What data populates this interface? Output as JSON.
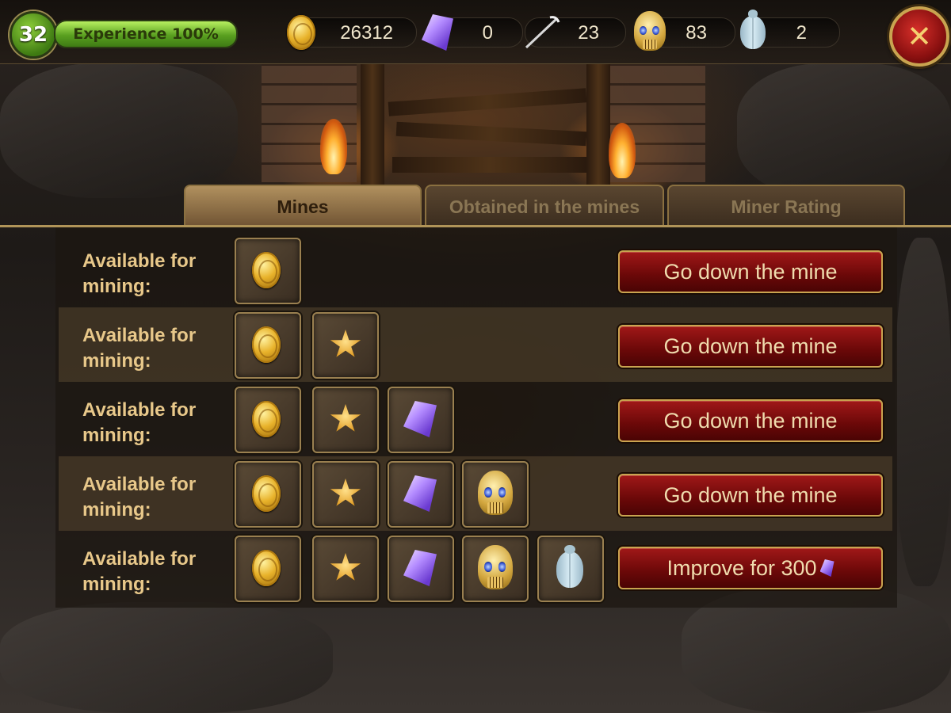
{
  "header": {
    "level": "32",
    "experience_label": "Experience 100%",
    "experience_progress": 1.0,
    "resources": [
      {
        "icon": "coin-icon",
        "value": "26312"
      },
      {
        "icon": "crystal-icon",
        "value": "0"
      },
      {
        "icon": "pickaxe-icon",
        "value": "23"
      },
      {
        "icon": "golden-skull-icon",
        "value": "83"
      },
      {
        "icon": "scarab-icon",
        "value": "2"
      }
    ],
    "close_label": "✕"
  },
  "tabs": [
    {
      "label": "Mines",
      "active": true
    },
    {
      "label": "Obtained in the mines",
      "active": false
    },
    {
      "label": "Miner Rating",
      "active": false
    }
  ],
  "mines": [
    {
      "label": "Available for mining:",
      "rewards": [
        "coin-icon"
      ],
      "action": "Go down the mine"
    },
    {
      "label": "Available for mining:",
      "rewards": [
        "coin-icon",
        "star-icon"
      ],
      "action": "Go down the mine"
    },
    {
      "label": "Available for mining:",
      "rewards": [
        "coin-icon",
        "star-icon",
        "crystal-icon"
      ],
      "action": "Go down the mine"
    },
    {
      "label": "Available for mining:",
      "rewards": [
        "coin-icon",
        "star-icon",
        "crystal-icon",
        "golden-skull-icon"
      ],
      "action": "Go down the mine"
    },
    {
      "label": "Available for mining:",
      "rewards": [
        "coin-icon",
        "star-icon",
        "crystal-icon",
        "golden-skull-icon",
        "scarab-icon"
      ],
      "action": "Improve for 300",
      "action_icon": "crystal-icon"
    }
  ],
  "colors": {
    "experience_bar": "#5aa020",
    "action_button": "#8a1010",
    "tab_active": "#b0905e",
    "label_text": "#e8c88a"
  }
}
